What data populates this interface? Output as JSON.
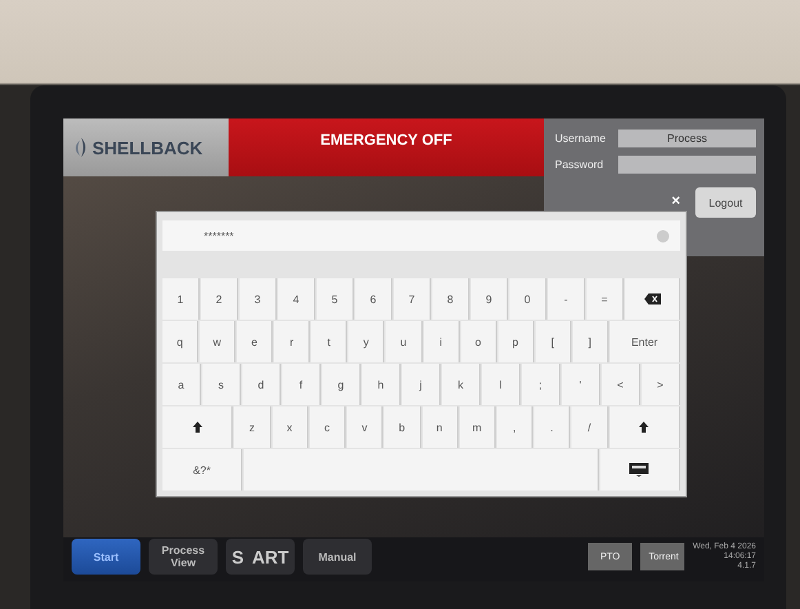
{
  "header": {
    "logo": "SHELLBACK",
    "alarm": "EMERGENCY OFF",
    "login": {
      "username_label": "Username",
      "username": "Process",
      "password_label": "Password",
      "logout": "Logout"
    }
  },
  "keyboard": {
    "input_value": "*******",
    "close": "×",
    "rows": [
      [
        {
          "kind": "char",
          "label": "1"
        },
        {
          "kind": "char",
          "label": "2"
        },
        {
          "kind": "char",
          "label": "3"
        },
        {
          "kind": "char",
          "label": "4"
        },
        {
          "kind": "char",
          "label": "5"
        },
        {
          "kind": "char",
          "label": "6"
        },
        {
          "kind": "char",
          "label": "7"
        },
        {
          "kind": "char",
          "label": "8"
        },
        {
          "kind": "char",
          "label": "9"
        },
        {
          "kind": "char",
          "label": "0"
        },
        {
          "kind": "char",
          "label": "-"
        },
        {
          "kind": "char",
          "label": "="
        },
        {
          "kind": "backspace"
        }
      ],
      [
        {
          "kind": "char",
          "label": "q"
        },
        {
          "kind": "char",
          "label": "w"
        },
        {
          "kind": "char",
          "label": "e"
        },
        {
          "kind": "char",
          "label": "r"
        },
        {
          "kind": "char",
          "label": "t"
        },
        {
          "kind": "char",
          "label": "y"
        },
        {
          "kind": "char",
          "label": "u"
        },
        {
          "kind": "char",
          "label": "i"
        },
        {
          "kind": "char",
          "label": "o"
        },
        {
          "kind": "char",
          "label": "p"
        },
        {
          "kind": "char",
          "label": "["
        },
        {
          "kind": "char",
          "label": "]"
        },
        {
          "kind": "wide",
          "label": "Enter"
        }
      ],
      [
        {
          "kind": "char",
          "label": "a"
        },
        {
          "kind": "char",
          "label": "s"
        },
        {
          "kind": "char",
          "label": "d"
        },
        {
          "kind": "char",
          "label": "f"
        },
        {
          "kind": "char",
          "label": "g"
        },
        {
          "kind": "char",
          "label": "h"
        },
        {
          "kind": "char",
          "label": "j"
        },
        {
          "kind": "char",
          "label": "k"
        },
        {
          "kind": "char",
          "label": "l"
        },
        {
          "kind": "char",
          "label": ";"
        },
        {
          "kind": "char",
          "label": "'"
        },
        {
          "kind": "char",
          "label": "<"
        },
        {
          "kind": "char",
          "label": ">"
        }
      ],
      [
        {
          "kind": "shift"
        },
        {
          "kind": "char",
          "label": "z"
        },
        {
          "kind": "char",
          "label": "x"
        },
        {
          "kind": "char",
          "label": "c"
        },
        {
          "kind": "char",
          "label": "v"
        },
        {
          "kind": "char",
          "label": "b"
        },
        {
          "kind": "char",
          "label": "n"
        },
        {
          "kind": "char",
          "label": "m"
        },
        {
          "kind": "char",
          "label": ","
        },
        {
          "kind": "char",
          "label": "."
        },
        {
          "kind": "char",
          "label": "/"
        },
        {
          "kind": "shift"
        }
      ],
      [
        {
          "kind": "wide",
          "label": "&?*"
        },
        {
          "kind": "space"
        },
        {
          "kind": "hide"
        }
      ]
    ]
  },
  "footer": {
    "nav": [
      {
        "kind": "text",
        "label": "Start",
        "selected": true
      },
      {
        "kind": "text",
        "label": "Process View",
        "selected": false
      },
      {
        "kind": "logo",
        "label": "S",
        "label2": "ART",
        "selected": false
      },
      {
        "kind": "text",
        "label": "Manual",
        "selected": false
      }
    ],
    "modes": [
      "PTO",
      "Torrent"
    ],
    "date": "Wed, Feb 4 2026",
    "time": "14:06:17",
    "version": "4.1.7"
  }
}
